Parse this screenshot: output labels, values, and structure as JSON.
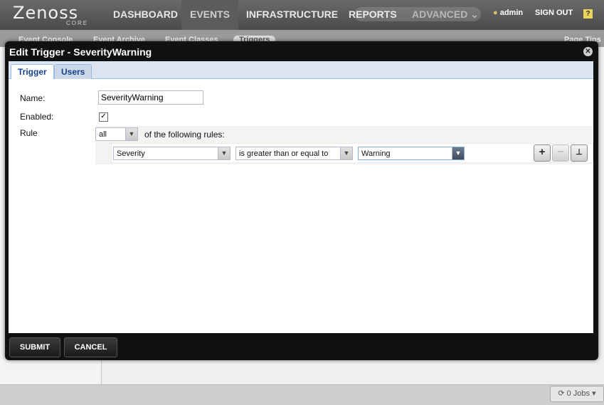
{
  "app": {
    "logo": "Zenoss",
    "logo_sub": "CORE"
  },
  "nav": {
    "items": [
      {
        "label": "DASHBOARD"
      },
      {
        "label": "EVENTS"
      },
      {
        "label": "INFRASTRUCTURE"
      },
      {
        "label": "REPORTS"
      },
      {
        "label": "ADVANCED"
      }
    ],
    "user": "admin",
    "signout": "SIGN OUT",
    "help": "?"
  },
  "subnav": {
    "items": [
      {
        "label": "Event Console"
      },
      {
        "label": "Event Archive"
      },
      {
        "label": "Event Classes"
      },
      {
        "label": "Triggers"
      }
    ],
    "right": "Page Tips"
  },
  "dialog": {
    "title": "Edit Trigger - SeverityWarning",
    "tabs": [
      {
        "label": "Trigger"
      },
      {
        "label": "Users"
      }
    ],
    "name_label": "Name:",
    "name_value": "SeverityWarning",
    "enabled_label": "Enabled:",
    "enabled_checked": "✓",
    "rule_label": "Rule",
    "match_value": "all",
    "match_suffix": "of the following rules:",
    "rule": {
      "field": "Severity",
      "operator": "is greater than or equal to",
      "value": "Warning"
    },
    "buttons": {
      "submit": "SUBMIT",
      "cancel": "CANCEL"
    }
  },
  "status": {
    "jobs": "0 Jobs"
  }
}
